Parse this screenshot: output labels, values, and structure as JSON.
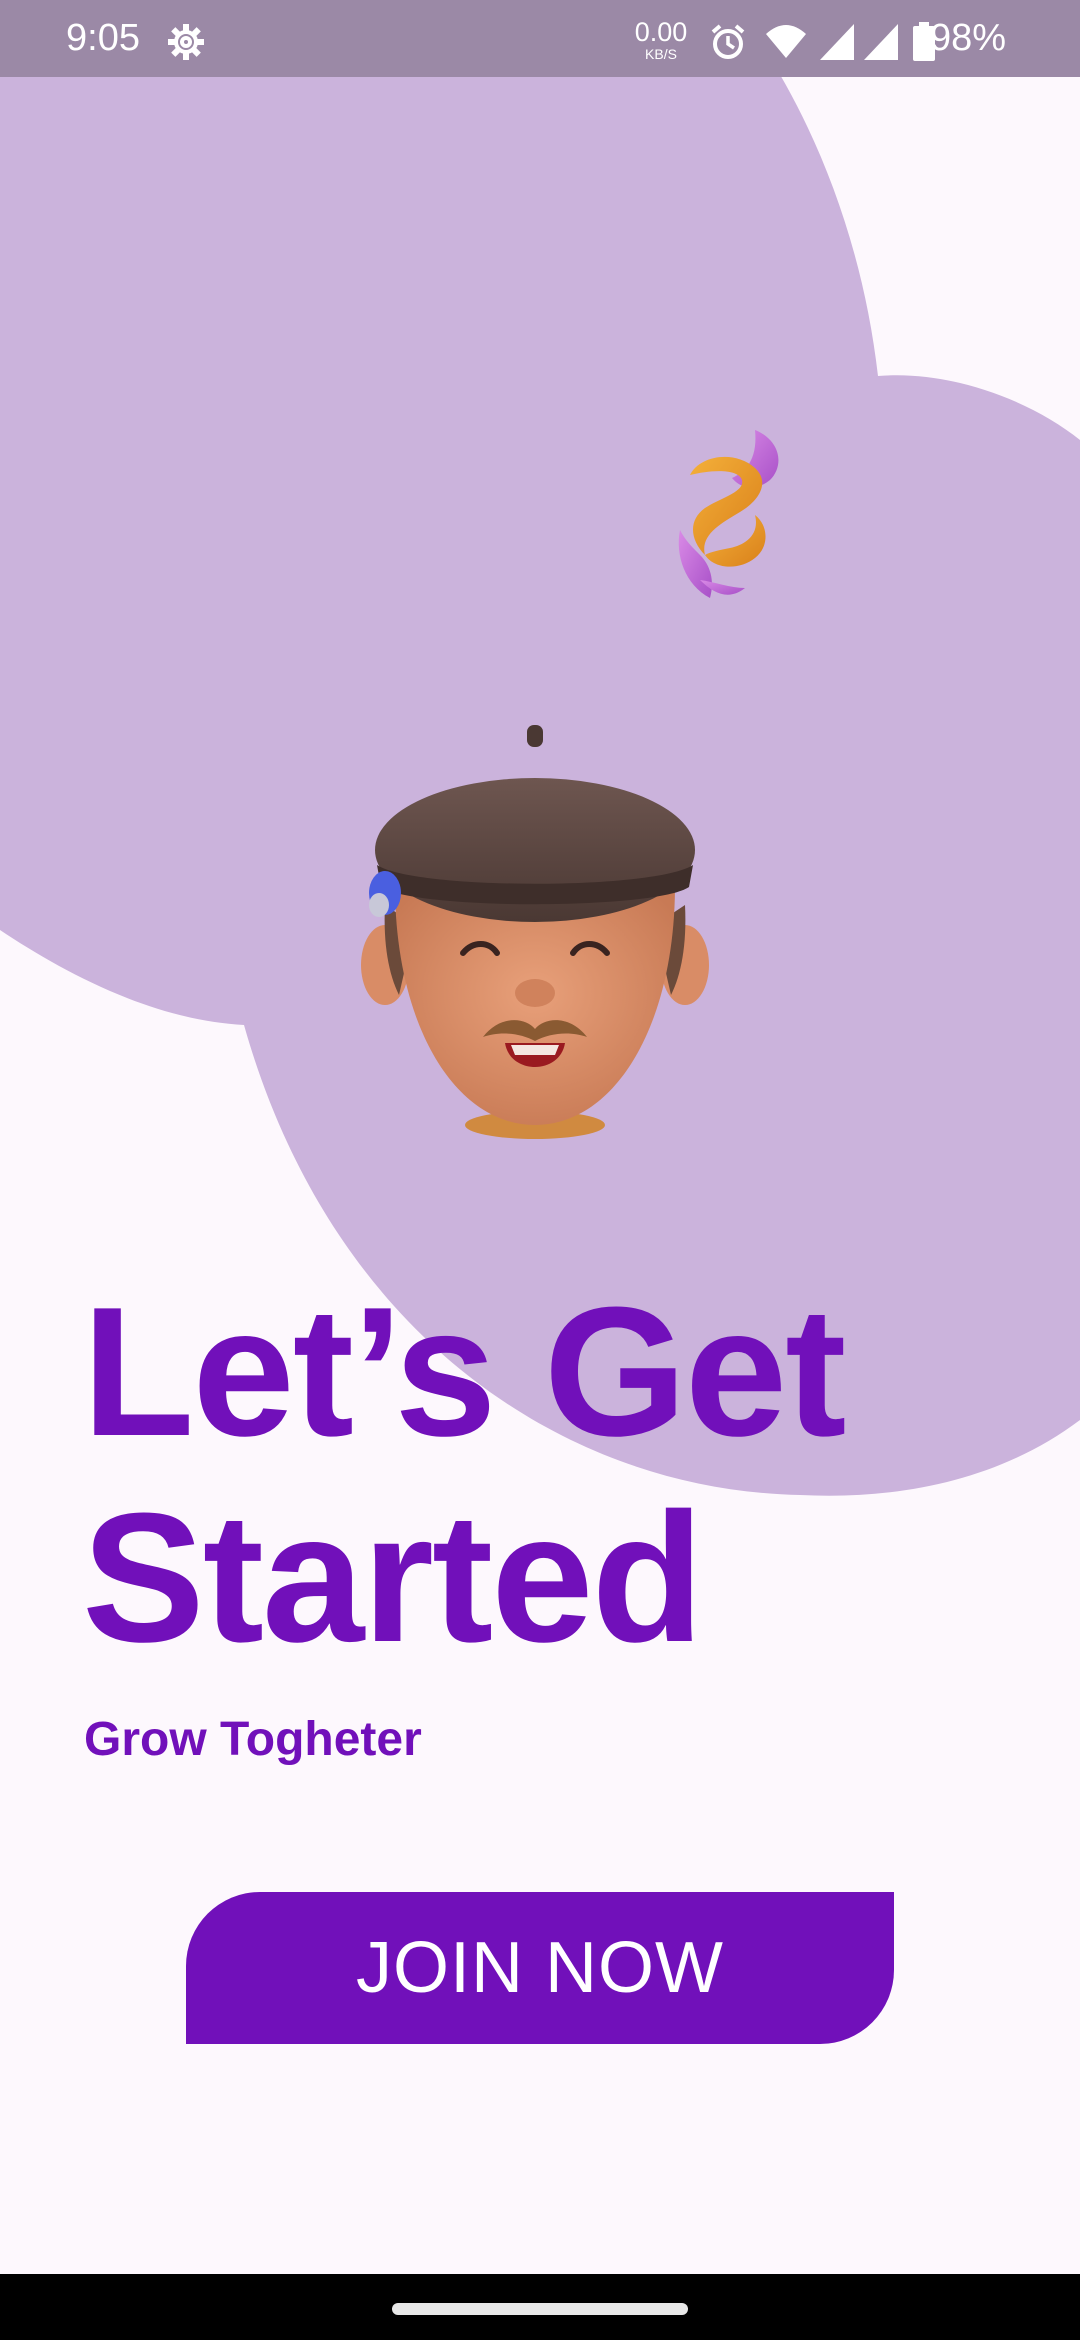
{
  "status_bar": {
    "time": "9:05",
    "net_speed_value": "0.00",
    "net_speed_unit": "KB/S",
    "battery": "98%",
    "icons": [
      "settings-gear-icon",
      "alarm-icon",
      "wifi-icon",
      "signal-icon",
      "signal-icon",
      "battery-icon"
    ]
  },
  "onboarding": {
    "headline_line1": "Let’s Get",
    "headline_line2": "Started",
    "subtitle": "Grow Togheter",
    "join_button_label": "JOIN NOW"
  },
  "colors": {
    "accent": "#7110ba",
    "blob": "#cbb3dc",
    "background": "#fdf8fd",
    "status_bar": "#9b89a6"
  }
}
